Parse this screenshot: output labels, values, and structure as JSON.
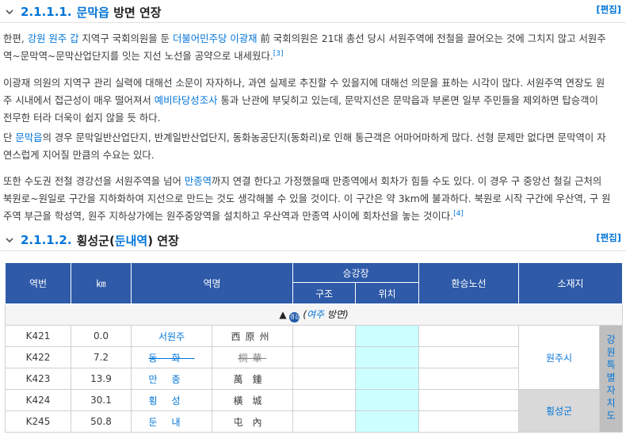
{
  "section1": {
    "number": "2.1.1.1.",
    "title_link": "문막읍",
    "title_rest": "방면 연장",
    "edit": "[편집]"
  },
  "para1": {
    "line1_a": "한편,",
    "line1_link1": "강원 원주 갑",
    "line1_b": "지역구 국회의원을 둔",
    "line1_link2": "더불어민주당 이광재",
    "line1_c": "前 국회의원은 21대 총선 당시 서원주역에 전철을 끌어오는 것에 그치지 않고 서원주",
    "line2": "역~문막역~문막산업단지를 잇는 지선 노선을 공약으로 내세웠다.",
    "ref": "[3]"
  },
  "para2": {
    "line1": "이광재 의원의 지역구 관리 실력에 대해선 소문이 자자하나, 과연 실제로 추진할 수 있을지에 대해선 의문을 표하는 시각이 많다. 서원주역 연장도 원",
    "line2_a": "주 시내에서 접근성이 매우 떨어져서",
    "line2_link": "예비타당성조사",
    "line2_b": "통과 난관에 부딪히고 있는데, 문막지선은 문막읍과 부론면 일부 주민들을 제외하면 탑승객이",
    "line3": "전무한 터라 더욱이 쉽지 않을 듯 하다."
  },
  "para3": {
    "line1_a": "단",
    "line1_link": "문막읍",
    "line1_b": "의 경우 문막일반산업단지, 반계일반산업단지, 동화농공단지(동화리)로 인해 통근객은 어마어마하게 많다. 선형 문제만 없다면 문막역이 자",
    "line2": "연스럽게 지어질 만큼의 수요는 있다."
  },
  "para4": {
    "line1_a": "또한 수도권 전철 경강선을 서원주역을 넘어",
    "line1_link": "만종역",
    "line1_b": "까지 연결 한다고 가정했을때 만종역에서 회차가 힘들 수도 있다. 이 경우 구 중앙선 철길 근처의",
    "line2": "북원로~원일로 구간을 지하화하여 지선으로 만드는 것도 생각해볼 수 있을 것이다. 이 구간은 약 3km에 불과하다. 북원로 시작 구간에 우산역, 구 원",
    "line3": "주역 부근을 학성역, 원주 지하상가에는 원주중앙역을 설치하고 우산역과 만종역 사이에 회차선을 놓는 것이다.",
    "ref": "[4]"
  },
  "section2": {
    "number": "2.1.1.2.",
    "title_a": "횡성군(",
    "title_link": "둔내역",
    "title_b": ") 연장",
    "edit": "[편집]"
  },
  "table": {
    "headers": {
      "station_no": "역번",
      "km": "㎞",
      "station_name": "역명",
      "platform": "승강장",
      "structure": "구조",
      "position": "위치",
      "transfer": "환승노선",
      "location": "소재지"
    },
    "direction": {
      "arrow": "▲",
      "badge": "경강",
      "text_open": "(",
      "text_link": "여주",
      "text_rest": "방면)"
    },
    "rows": [
      {
        "no": "K421",
        "km": "0.0",
        "name": "서원주",
        "hanja": "西原州"
      },
      {
        "no": "K422",
        "km": "7.2",
        "name": "동화",
        "hanja": "桐華"
      },
      {
        "no": "K423",
        "km": "13.9",
        "name": "만종",
        "hanja": "萬鍾"
      },
      {
        "no": "K424",
        "km": "30.1",
        "name": "횡성",
        "hanja": "橫城"
      },
      {
        "no": "K245",
        "km": "50.8",
        "name": "둔내",
        "hanja": "屯內"
      }
    ],
    "loc_wonju": "원주시",
    "loc_hoengseong": "횡성군",
    "province": "강원특별자치도"
  },
  "colors": {
    "link": "#0275d8",
    "header_bg": "#2e5aa8",
    "cyan_cell": "#ccffff"
  }
}
